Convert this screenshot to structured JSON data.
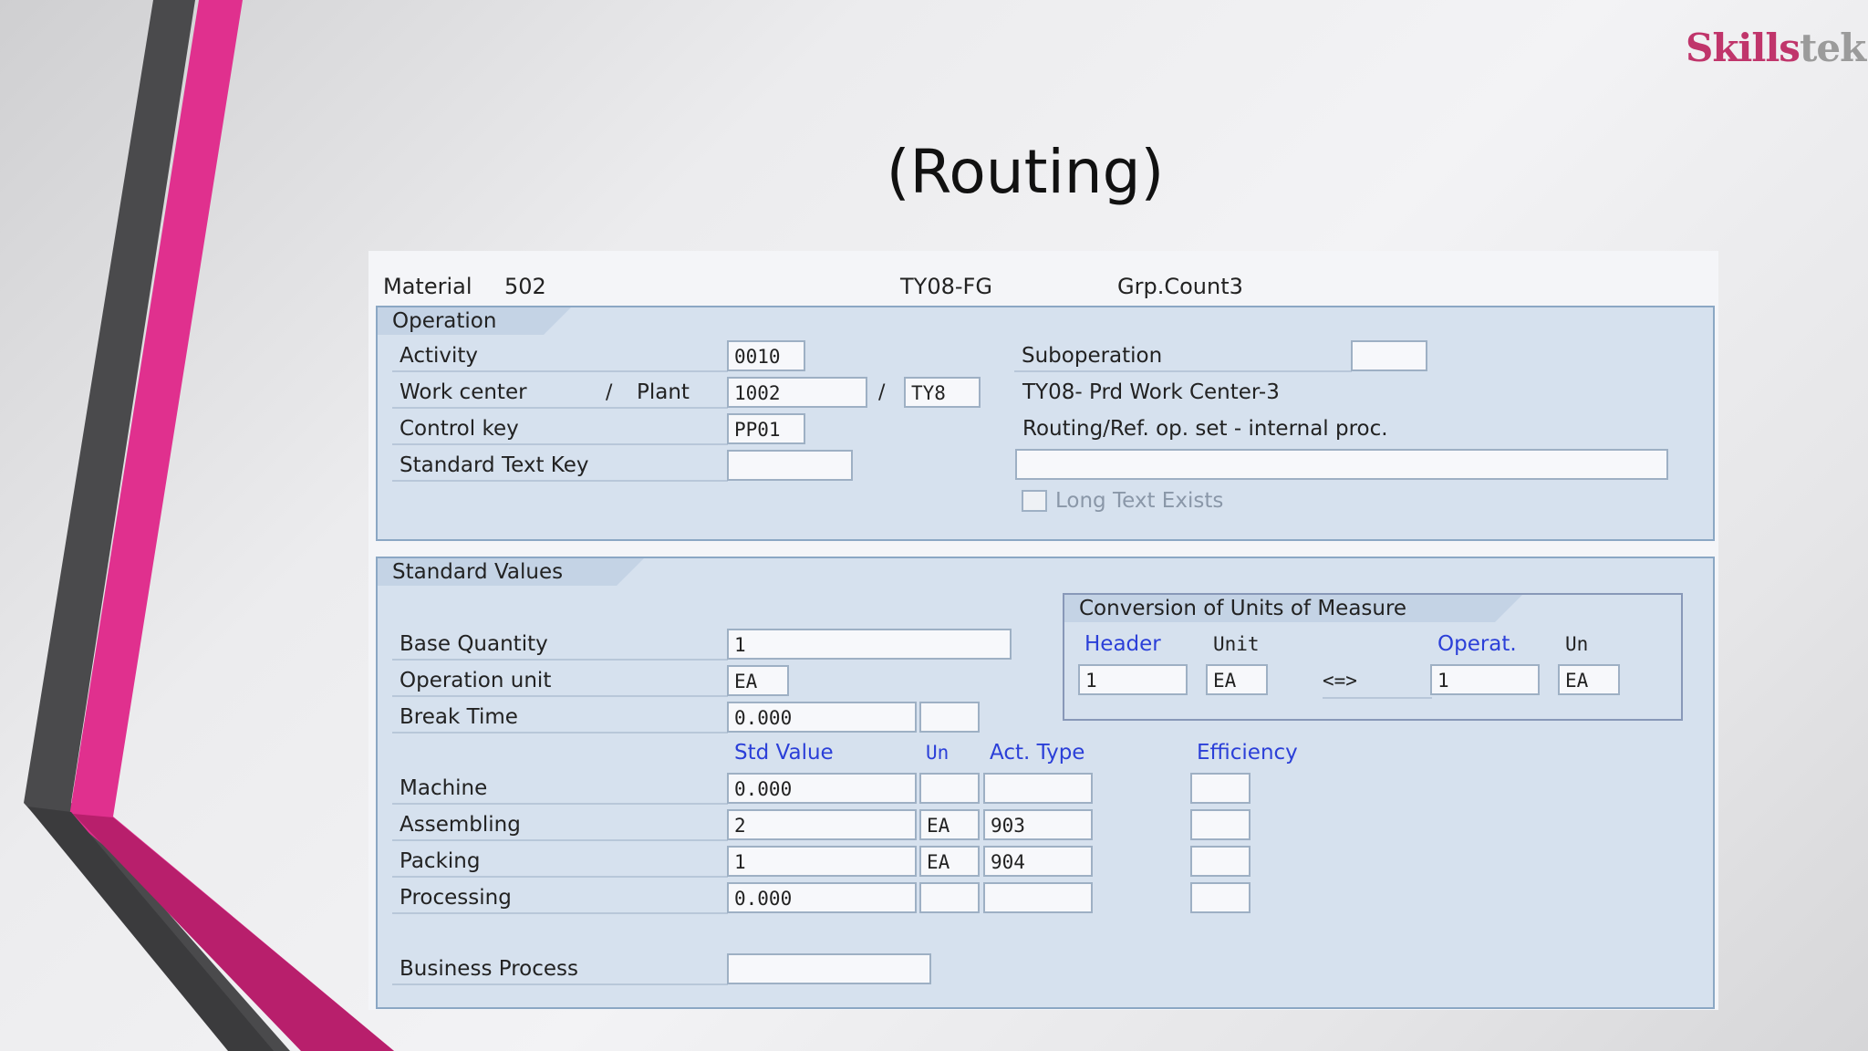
{
  "brand": {
    "part1": "Skills",
    "part2": "tek"
  },
  "slide_title": "(Routing)",
  "header": {
    "material_label": "Material",
    "material_value": "502",
    "group": "TY08-FG",
    "grp_count": "Grp.Count3"
  },
  "operation": {
    "tab": "Operation",
    "activity_label": "Activity",
    "activity_value": "0010",
    "work_center_label": "Work center",
    "plant_label": "Plant",
    "work_center_value": "1002",
    "plant_value": "TY8",
    "control_key_label": "Control key",
    "control_key_value": "PP01",
    "std_text_key_label": "Standard Text Key",
    "std_text_key_value": "",
    "suboperation_label": "Suboperation",
    "suboperation_value": "",
    "work_center_desc": "TY08- Prd Work Center-3",
    "control_key_desc": "Routing/Ref. op. set - internal proc.",
    "description_value": "",
    "long_text_label": "Long Text Exists"
  },
  "standard_values": {
    "tab": "Standard Values",
    "base_qty_label": "Base Quantity",
    "base_qty_value": "1",
    "op_unit_label": "Operation unit",
    "op_unit_value": "EA",
    "break_time_label": "Break Time",
    "break_time_value": "0.000",
    "break_time_unit": "",
    "col_std_value": "Std Value",
    "col_un": "Un",
    "col_act_type": "Act. Type",
    "col_efficiency": "Efficiency",
    "rows": [
      {
        "label": "Machine",
        "value": "0.000",
        "un": "",
        "act": "",
        "eff": ""
      },
      {
        "label": "Assembling",
        "value": "2",
        "un": "EA",
        "act": "903",
        "eff": ""
      },
      {
        "label": "Packing",
        "value": "1",
        "un": "EA",
        "act": "904",
        "eff": ""
      },
      {
        "label": "Processing",
        "value": "0.000",
        "un": "",
        "act": "",
        "eff": ""
      }
    ],
    "business_process_label": "Business Process",
    "business_process_value": ""
  },
  "conversion": {
    "title": "Conversion of Units of Measure",
    "header_label": "Header",
    "unit_label": "Unit",
    "operat_label": "Operat.",
    "un_label": "Un",
    "header_value": "1",
    "header_unit": "EA",
    "arrow": "<=>",
    "operat_value": "1",
    "operat_unit": "EA"
  }
}
